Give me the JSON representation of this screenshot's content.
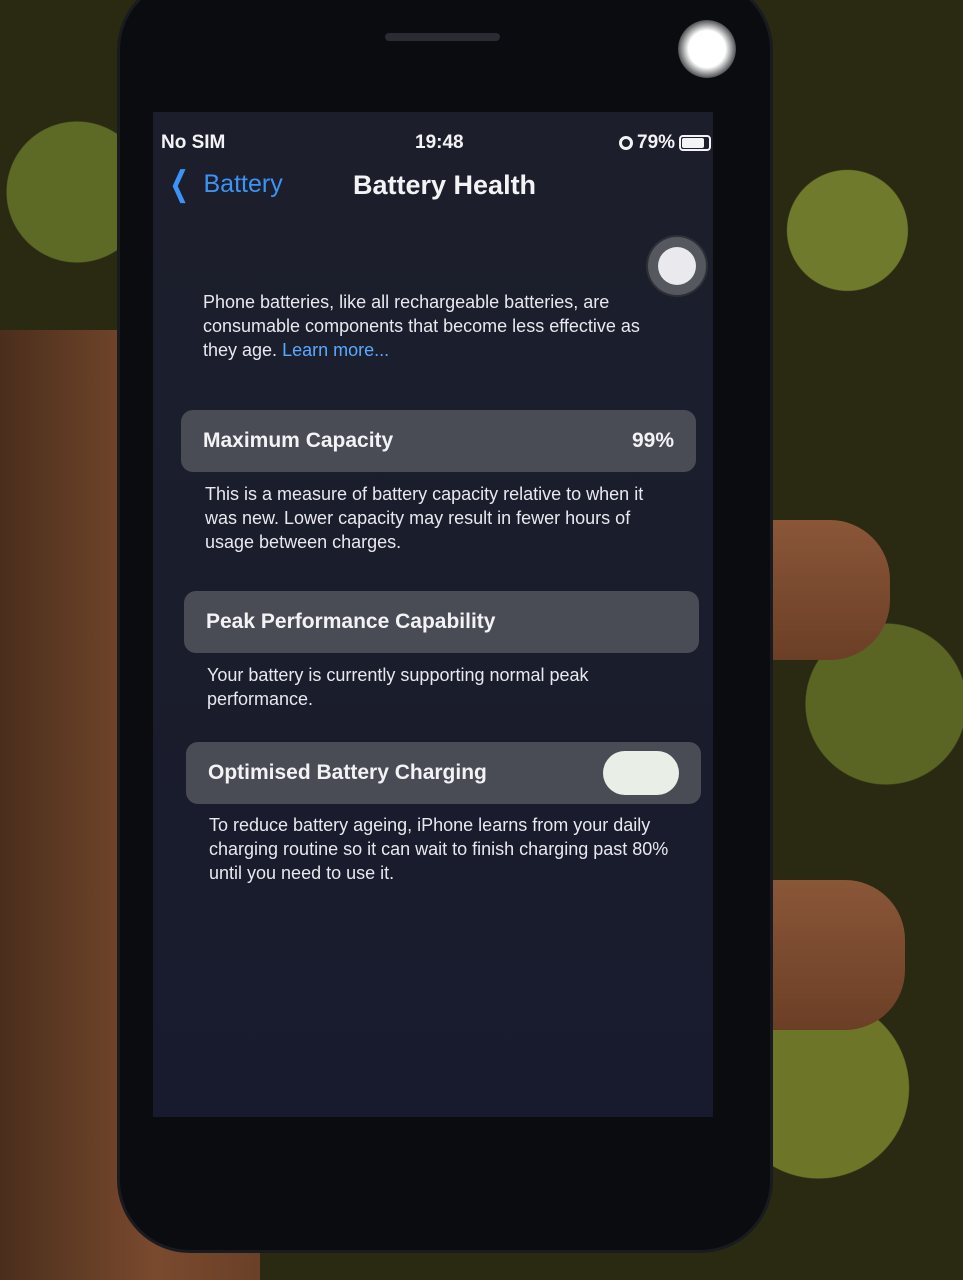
{
  "status_bar": {
    "carrier": "No SIM",
    "time": "19:48",
    "battery_pct": "79%"
  },
  "nav": {
    "back_label": "Battery",
    "title": "Battery Health"
  },
  "intro": {
    "text": "Phone batteries, like all rechargeable batteries, are consumable components that become less effective as they age. ",
    "link": "Learn more..."
  },
  "max_capacity": {
    "label": "Maximum Capacity",
    "value": "99%",
    "description": "This is a measure of battery capacity relative to when it was new. Lower capacity may result in fewer hours of usage between charges."
  },
  "peak_performance": {
    "label": "Peak Performance Capability",
    "description": "Your battery is currently supporting normal peak performance."
  },
  "optimised_charging": {
    "label": "Optimised Battery Charging",
    "enabled": true,
    "description": "To reduce battery ageing, iPhone learns from your daily charging routine so it can wait to finish charging past 80% until you need to use it."
  },
  "colors": {
    "accent": "#3b93f5",
    "link": "#5aa9ff",
    "row_bg": "#4a4c55",
    "screen_bg": "#1c1f2b"
  }
}
